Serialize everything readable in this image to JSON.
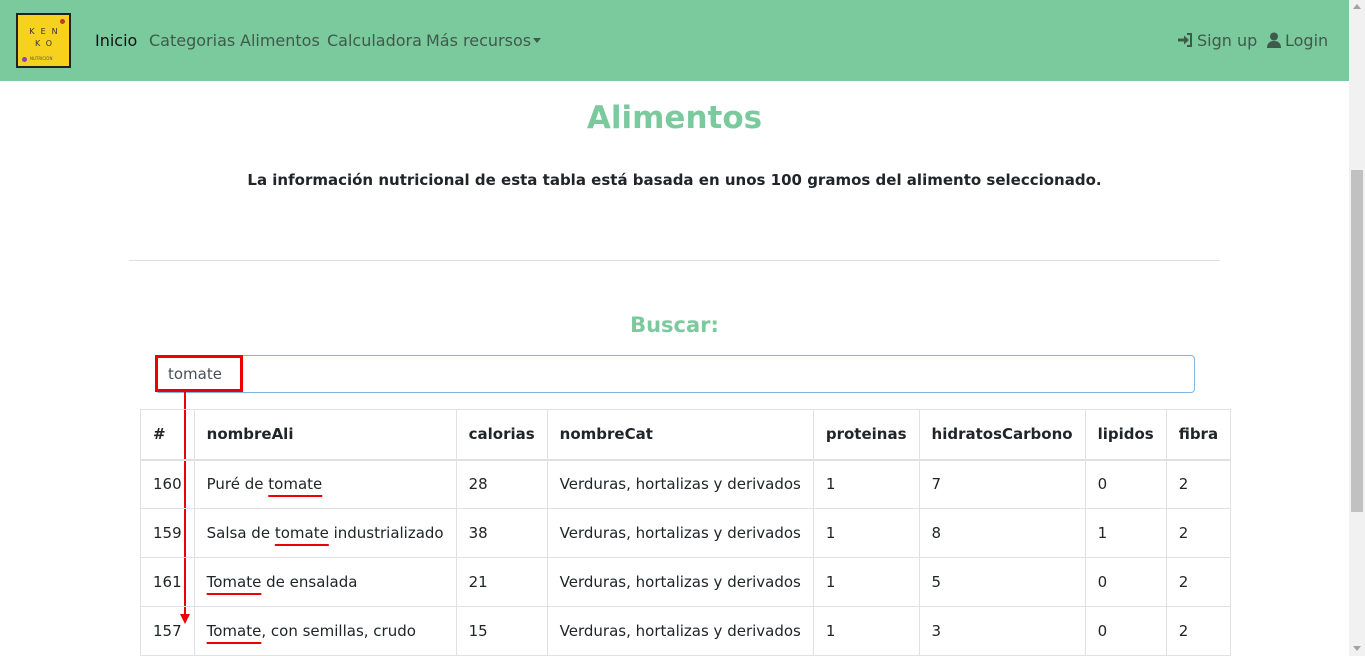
{
  "nav": {
    "logo": {
      "line1": "KEN",
      "line2": "KO",
      "line3": "NUTRICIÓN"
    },
    "links": [
      "Inicio",
      "Categorias",
      "Alimentos",
      "Calculadora",
      "Más recursos"
    ],
    "signup": "Sign up",
    "login": "Login"
  },
  "page": {
    "title": "Alimentos",
    "subtitle": "La información nutricional de esta tabla está basada en unos 100 gramos del alimento seleccionado.",
    "search_title": "Buscar:"
  },
  "search": {
    "value": "tomate"
  },
  "table": {
    "headers": [
      "#",
      "nombreAli",
      "calorias",
      "nombreCat",
      "proteinas",
      "hidratosCarbono",
      "lipidos",
      "fibra"
    ],
    "rows": [
      {
        "id": "160",
        "name_pre": "Puré de ",
        "name_match": "tomate",
        "name_post": "",
        "calorias": "28",
        "categoria": "Verduras, hortalizas y derivados",
        "proteinas": "1",
        "hidratos": "7",
        "lipidos": "0",
        "fibra": "2"
      },
      {
        "id": "159",
        "name_pre": "Salsa de ",
        "name_match": "tomate",
        "name_post": " industrializado",
        "calorias": "38",
        "categoria": "Verduras, hortalizas y derivados",
        "proteinas": "1",
        "hidratos": "8",
        "lipidos": "1",
        "fibra": "2"
      },
      {
        "id": "161",
        "name_pre": "",
        "name_match": "Tomate",
        "name_post": " de ensalada",
        "calorias": "21",
        "categoria": "Verduras, hortalizas y derivados",
        "proteinas": "1",
        "hidratos": "5",
        "lipidos": "0",
        "fibra": "2"
      },
      {
        "id": "157",
        "name_pre": "",
        "name_match": "Tomate",
        "name_post": ", con semillas, crudo",
        "calorias": "15",
        "categoria": "Verduras, hortalizas y derivados",
        "proteinas": "1",
        "hidratos": "3",
        "lipidos": "0",
        "fibra": "2"
      }
    ]
  }
}
